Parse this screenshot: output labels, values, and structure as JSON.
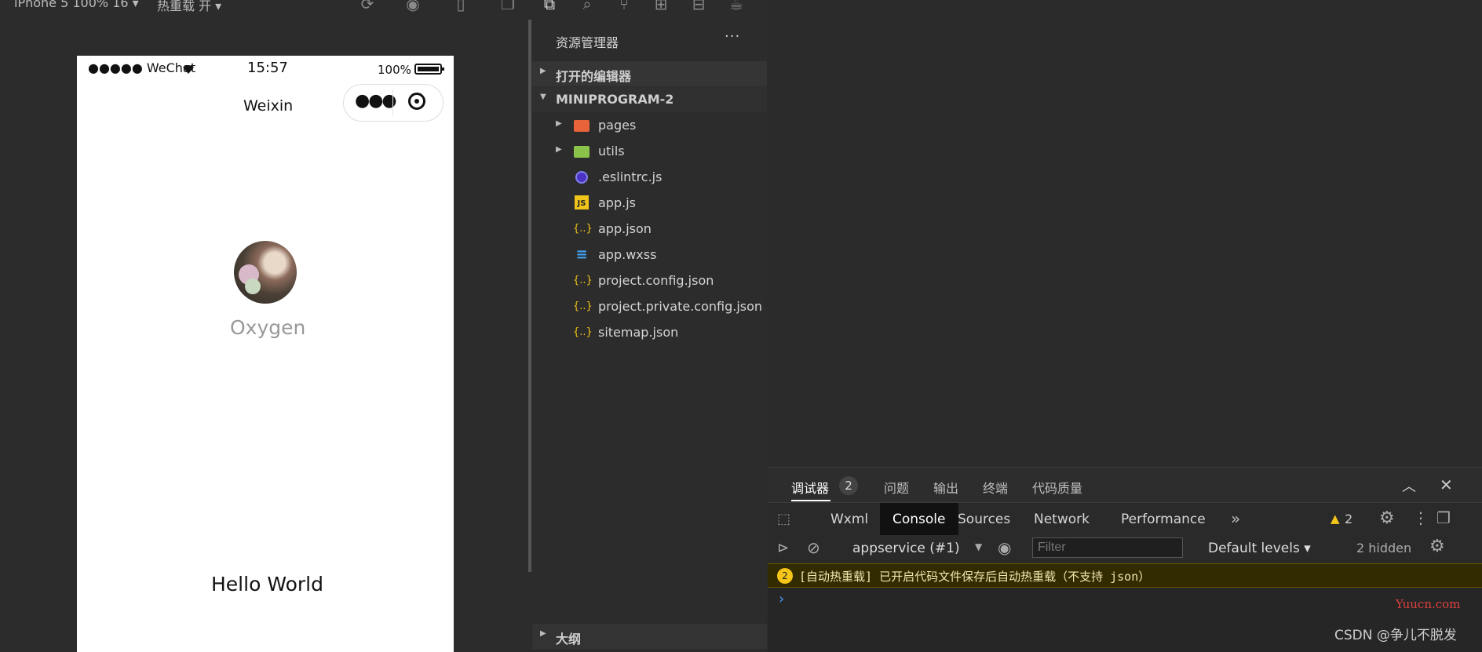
{
  "sim_toolbar": {
    "device": "iPhone 5 100% 16 ▾",
    "hot_reload": "热重载 开 ▾"
  },
  "phone": {
    "carrier": "●●●●● WeChat",
    "time": "15:57",
    "battery": "100%",
    "nav_title": "Weixin",
    "user_name": "Oxygen",
    "hello": "Hello World"
  },
  "explorer": {
    "title": "资源管理器",
    "more": "···",
    "open_editors": "打开的编辑器",
    "project": "MINIPROGRAM-2",
    "outline": "大纲",
    "files": [
      {
        "name": "pages",
        "icon": "folder-icon"
      },
      {
        "name": "utils",
        "icon": "folder-icon"
      },
      {
        "name": ".eslintrc.js",
        "icon": "eslint-icon"
      },
      {
        "name": "app.js",
        "icon": "js-file-icon"
      },
      {
        "name": "app.json",
        "icon": "json-file-icon"
      },
      {
        "name": "app.wxss",
        "icon": "css-file-icon"
      },
      {
        "name": "project.config.json",
        "icon": "json-file-icon"
      },
      {
        "name": "project.private.config.json",
        "icon": "json-file-icon"
      },
      {
        "name": "sitemap.json",
        "icon": "json-file-icon"
      }
    ]
  },
  "devtools": {
    "top_tabs": [
      "调试器",
      "问题",
      "输出",
      "终端",
      "代码质量"
    ],
    "debugger_badge": "2",
    "tabs": [
      "Wxml",
      "Console",
      "Sources",
      "Network",
      "Performance"
    ],
    "more_tabs": "»",
    "warn_count": "2",
    "context": "appservice (#1)",
    "filter_placeholder": "Filter",
    "levels": "Default levels ▾",
    "hidden": "2 hidden",
    "warn_badge": "2",
    "warn_message": "[自动热重载] 已开启代码文件保存后自动热重载（不支持 json）",
    "prompt": "›",
    "watermark1": "Yuucn.com",
    "watermark2": "CSDN @争儿不脱发"
  },
  "colors": {
    "accent_folder_pages": "#e8623a",
    "accent_folder_utils": "#8bc34a",
    "js": "#f0c419",
    "json": "#f0c419",
    "css": "#42a5f5",
    "warn_bg": "#332b00"
  }
}
